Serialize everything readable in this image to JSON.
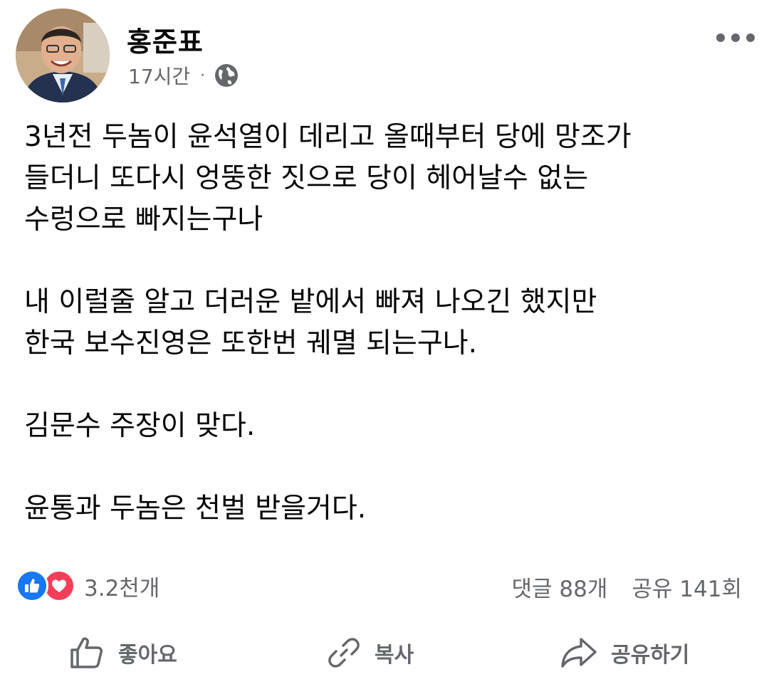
{
  "post": {
    "author": "홍준표",
    "time": "17시간",
    "dot": "·",
    "body": [
      "3년전 두놈이 윤석열이 데리고 올때부터 당에 망조가\n들더니 또다시 엉뚱한 짓으로 당이 헤어날수 없는\n수렁으로 빠지는구나",
      "내 이럴줄 알고  더러운 밭에서  빠져 나오긴 했지만\n한국 보수진영은 또한번 궤멸 되는구나.",
      "김문수 주장이 맞다.",
      "윤통과 두놈은 천벌 받을거다."
    ]
  },
  "reactions": {
    "count": "3.2천개",
    "icons": [
      "thumbs-up-icon",
      "heart-icon"
    ],
    "like_color": "#1877f2",
    "love_color": "#f33e58"
  },
  "stats": {
    "comments": "댓글 88개",
    "shares": "공유 141회"
  },
  "actions": {
    "like_label": "좋아요",
    "copy_label": "복사",
    "share_label": "공유하기"
  }
}
